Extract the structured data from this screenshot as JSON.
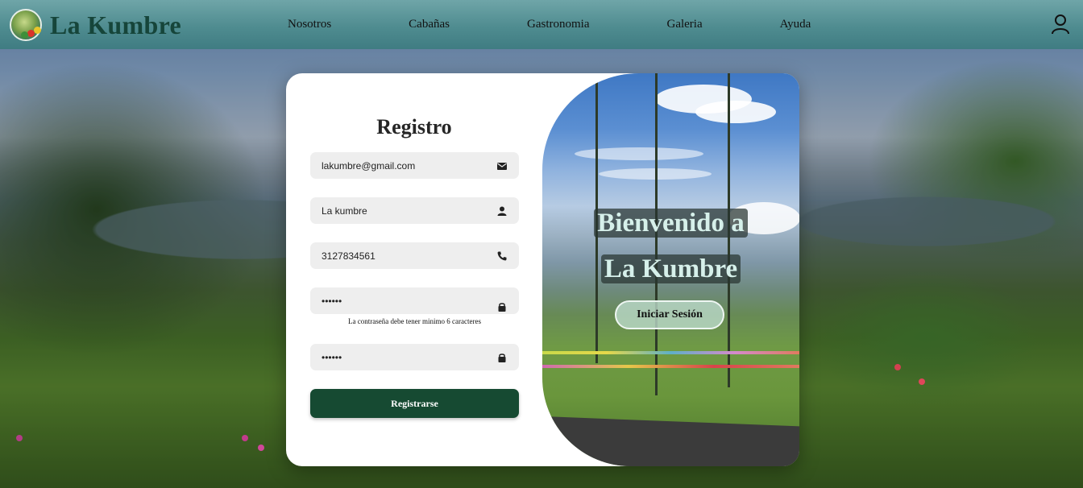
{
  "brand": {
    "name": "La Kumbre"
  },
  "nav": {
    "items": [
      "Nosotros",
      "Cabañas",
      "Gastronomia",
      "Galeria",
      "Ayuda"
    ]
  },
  "form": {
    "title": "Registro",
    "fields": [
      {
        "value": "lakumbre@gmail.com",
        "type": "email",
        "icon": "envelope-icon"
      },
      {
        "value": "La kumbre",
        "type": "text",
        "icon": "person-icon"
      },
      {
        "value": "3127834561",
        "type": "tel",
        "icon": "phone-icon"
      },
      {
        "value": "••••••",
        "type": "password",
        "icon": "lock-icon"
      },
      {
        "value": "••••••",
        "type": "password",
        "icon": "lock-icon"
      }
    ],
    "password_hint": "La contraseña debe tener minimo 6 caracteres",
    "submit_label": "Registrarse"
  },
  "welcome": {
    "line1": "Bienvenido a",
    "line2": "La Kumbre",
    "login_label": "Iniciar Sesión"
  },
  "colors": {
    "header": "#4f8c90",
    "brand_text": "#16453a",
    "submit_bg": "#164a32",
    "input_bg": "#eeeeee",
    "welcome_text": "#d6f0ea"
  }
}
